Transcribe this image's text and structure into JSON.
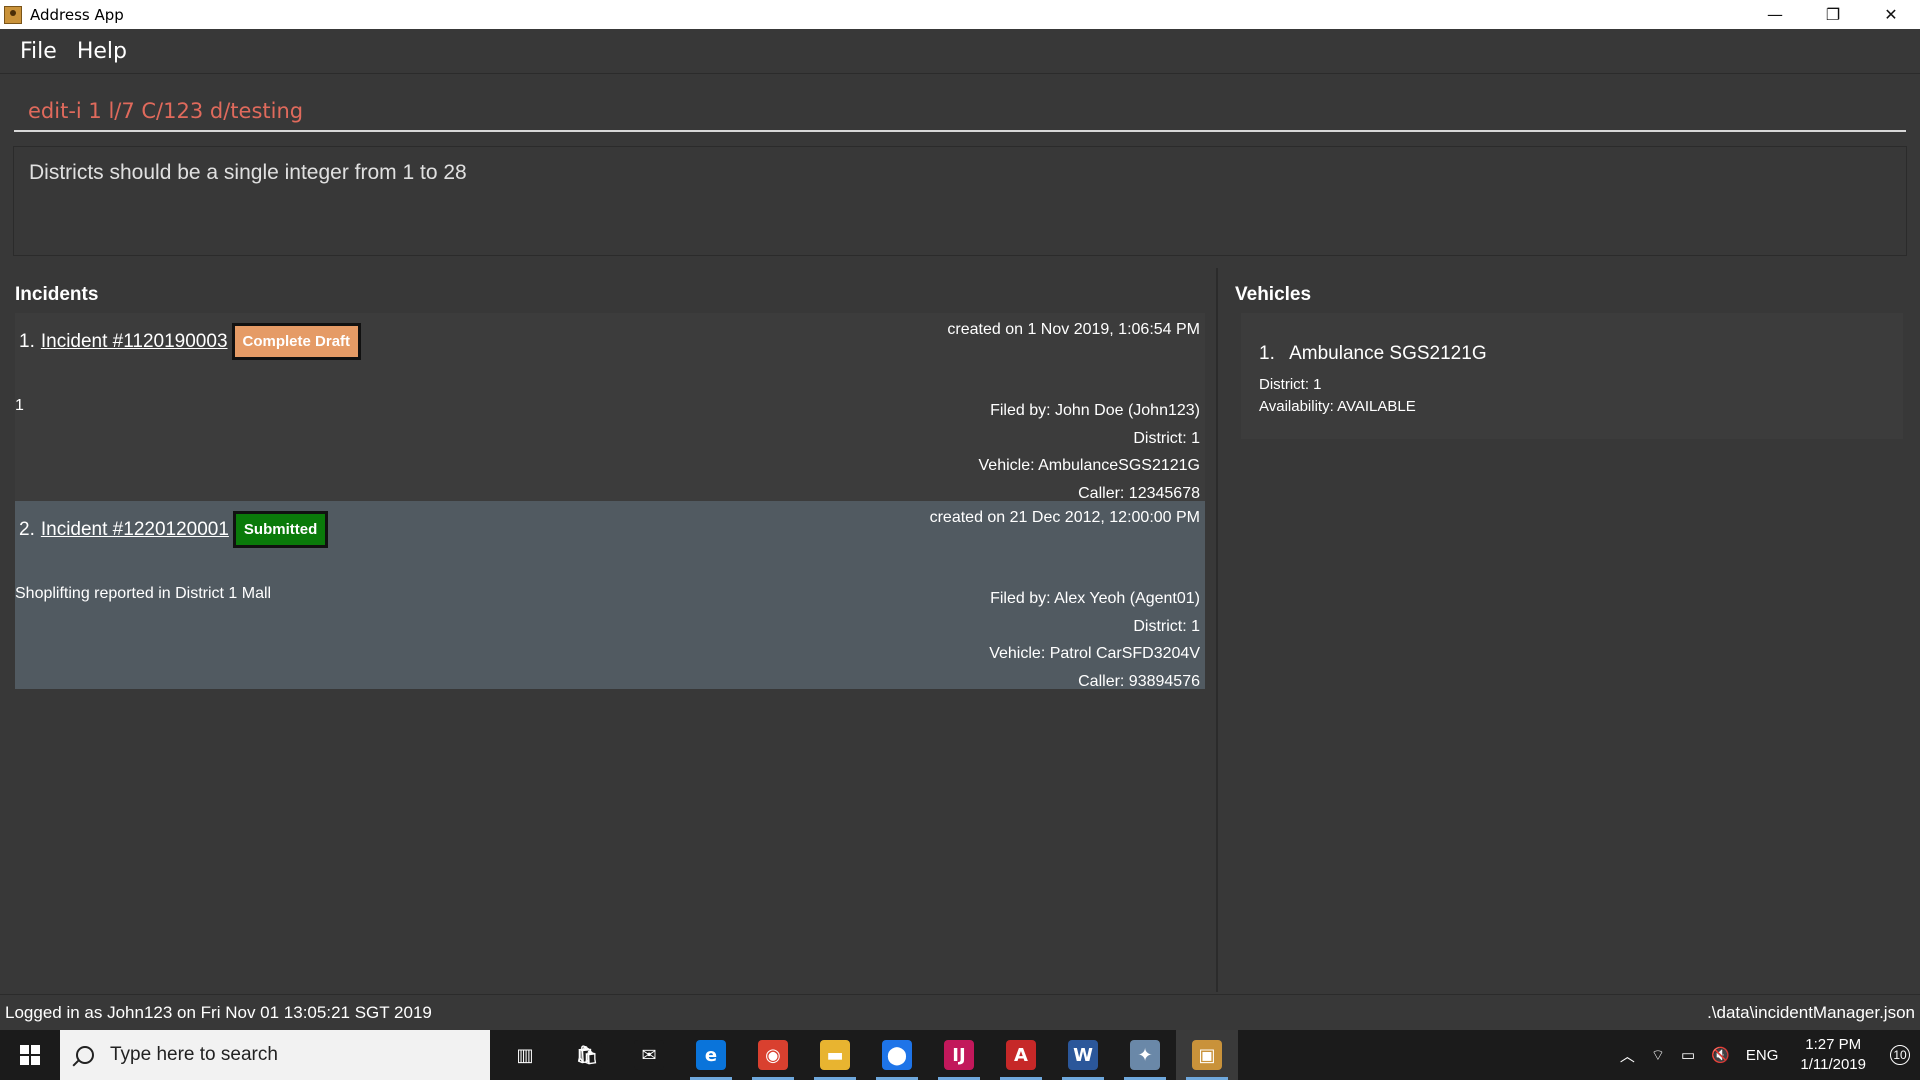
{
  "window": {
    "title": "Address App",
    "minimize": "—",
    "maximize": "❐",
    "close": "✕"
  },
  "menu": {
    "file": "File",
    "help": "Help"
  },
  "command": {
    "value": "edit-i 1 l/7 C/123 d/testing"
  },
  "result": {
    "text": "Districts should be a single integer from 1 to 28"
  },
  "incidents": {
    "header": "Incidents",
    "items": [
      {
        "index": "1.",
        "id": "Incident #1120190003",
        "status": "Complete Draft",
        "created": "created on 1 Nov 2019, 1:06:54 PM",
        "description": "1",
        "filed_by": "Filed by: John Doe (John123)",
        "district": "District: 1",
        "vehicle": "Vehicle: AmbulanceSGS2121G",
        "caller": "Caller: 12345678"
      },
      {
        "index": "2.",
        "id": "Incident #1220120001",
        "status": "Submitted",
        "created": "created on 21 Dec 2012, 12:00:00 PM",
        "description": "Shoplifting reported in District 1 Mall",
        "filed_by": "Filed by: Alex Yeoh (Agent01)",
        "district": "District: 1",
        "vehicle": "Vehicle: Patrol CarSFD3204V",
        "caller": "Caller: 93894576"
      }
    ]
  },
  "vehicles": {
    "header": "Vehicles",
    "items": [
      {
        "index": "1.",
        "name": "Ambulance SGS2121G",
        "district": "District: 1",
        "availability": "Availability: AVAILABLE"
      }
    ]
  },
  "status": {
    "left": "Logged in as John123 on Fri Nov 01 13:05:21 SGT 2019",
    "right": ".\\data\\incidentManager.json"
  },
  "taskbar": {
    "search_placeholder": "Type here to search",
    "language": "ENG",
    "time": "1:27 PM",
    "date": "1/11/2019",
    "notification_count": "10",
    "apps": [
      {
        "name": "task-view-icon",
        "glyph": "▥",
        "color": "#1b1b1b"
      },
      {
        "name": "store-icon",
        "glyph": "🛍",
        "color": "#1b1b1b"
      },
      {
        "name": "mail-icon",
        "glyph": "✉",
        "color": "#1b1b1b"
      },
      {
        "name": "edge-icon",
        "glyph": "e",
        "color": "#0a74da"
      },
      {
        "name": "chrome-icon",
        "glyph": "◉",
        "color": "#d9402f"
      },
      {
        "name": "file-explorer-icon",
        "glyph": "▬",
        "color": "#e8b430"
      },
      {
        "name": "maps-icon",
        "glyph": "⬤",
        "color": "#1e74e8"
      },
      {
        "name": "intellij-icon",
        "glyph": "IJ",
        "color": "#c2185b"
      },
      {
        "name": "acrobat-icon",
        "glyph": "A",
        "color": "#c62828"
      },
      {
        "name": "word-icon",
        "glyph": "W",
        "color": "#2b579a"
      },
      {
        "name": "eclipse-icon",
        "glyph": "✦",
        "color": "#6a88a8"
      },
      {
        "name": "address-app-icon",
        "glyph": "▣",
        "color": "#c9923a"
      }
    ]
  },
  "colors": {
    "background": "#383838",
    "command_text": "#e06a5c",
    "draft_badge": "#e59b66",
    "submitted_badge": "#0a7a0a",
    "selected_card": "#515a61"
  }
}
